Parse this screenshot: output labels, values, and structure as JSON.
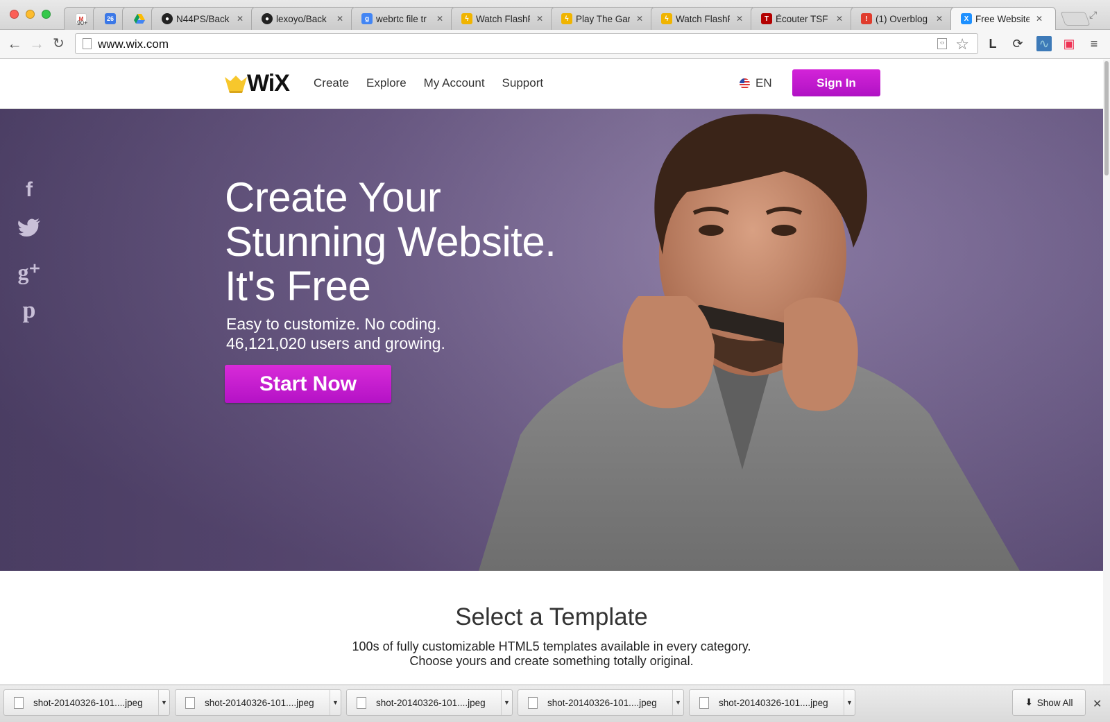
{
  "browser": {
    "tabs": [
      {
        "title": "",
        "favicon": "gmail-icon",
        "badge": "90+",
        "color": "#d93025"
      },
      {
        "title": "",
        "favicon": "calendar-icon",
        "badge": "26",
        "color": "#3b78e7"
      },
      {
        "title": "",
        "favicon": "drive-icon",
        "badge": "",
        "color": "#0f9d58"
      },
      {
        "title": "N44PS/Back",
        "favicon": "github-icon",
        "color": "#222222"
      },
      {
        "title": "lexoyo/Back",
        "favicon": "github-icon",
        "color": "#222222"
      },
      {
        "title": "webrtc file tr",
        "favicon": "google-icon",
        "color": "#4285f4"
      },
      {
        "title": "Watch FlashF",
        "favicon": "flash-icon",
        "color": "#f0b400"
      },
      {
        "title": "Play The Gar",
        "favicon": "flash-icon",
        "color": "#f0b400"
      },
      {
        "title": "Watch FlashF",
        "favicon": "flash-icon",
        "color": "#f0b400"
      },
      {
        "title": "Écouter TSF J",
        "favicon": "tsf-icon",
        "color": "#b30000"
      },
      {
        "title": "(1) Overblog",
        "favicon": "overblog-icon",
        "color": "#e03c2d"
      },
      {
        "title": "Free Website",
        "favicon": "wix-icon",
        "color": "#1e90ff"
      }
    ],
    "url": "www.wix.com"
  },
  "site": {
    "nav": [
      "Create",
      "Explore",
      "My Account",
      "Support"
    ],
    "lang": "EN",
    "signin": "Sign In",
    "hero": {
      "title_lines": [
        "Create Your",
        "Stunning Website.",
        "It's Free"
      ],
      "sub_lines": [
        "Easy to customize. No coding.",
        "46,121,020 users and growing."
      ],
      "cta": "Start Now"
    },
    "template": {
      "title": "Select a Template",
      "sub_lines": [
        "100s of fully customizable HTML5 templates available in every category.",
        "Choose yours and create something totally original."
      ]
    },
    "social": [
      "facebook-icon",
      "twitter-icon",
      "google-plus-icon",
      "pinterest-icon"
    ]
  },
  "downloads": {
    "items": [
      "shot-20140326-101....jpeg",
      "shot-20140326-101....jpeg",
      "shot-20140326-101....jpeg",
      "shot-20140326-101....jpeg",
      "shot-20140326-101....jpeg"
    ],
    "show_all": "Show All"
  },
  "colors": {
    "accent": "#c41bd1",
    "hero_bg": "#6a5788"
  }
}
